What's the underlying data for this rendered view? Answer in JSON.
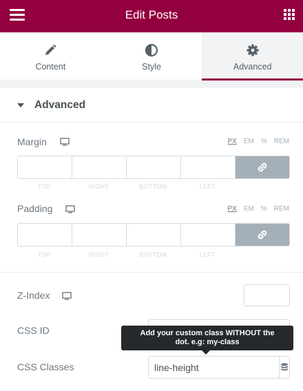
{
  "header": {
    "title": "Edit Posts",
    "menu_icon": "hamburger-icon",
    "apps_icon": "grid-icon"
  },
  "tabs": [
    {
      "label": "Content",
      "icon": "pencil-icon",
      "active": false
    },
    {
      "label": "Style",
      "icon": "half-circle-icon",
      "active": false
    },
    {
      "label": "Advanced",
      "icon": "gear-icon",
      "active": true
    }
  ],
  "section": {
    "title": "Advanced"
  },
  "margin": {
    "label": "Margin",
    "units": [
      "PX",
      "EM",
      "%",
      "REM"
    ],
    "selected_unit": "PX",
    "sides": [
      "TOP",
      "RIGHT",
      "BOTTOM",
      "LEFT"
    ]
  },
  "padding": {
    "label": "Padding",
    "units": [
      "PX",
      "EM",
      "%",
      "REM"
    ],
    "selected_unit": "PX",
    "sides": [
      "TOP",
      "RIGHT",
      "BOTTOM",
      "LEFT"
    ]
  },
  "zindex": {
    "label": "Z-Index",
    "value": ""
  },
  "cssid": {
    "label": "CSS ID",
    "value": ""
  },
  "cssclasses": {
    "label": "CSS Classes",
    "value": "line-height"
  },
  "tooltip": {
    "line1": "Add your custom class WITHOUT the",
    "line2": "dot. e.g: my-class"
  },
  "colors": {
    "brand": "#93003f",
    "link_button": "#a4afb7",
    "text": "#495157"
  }
}
